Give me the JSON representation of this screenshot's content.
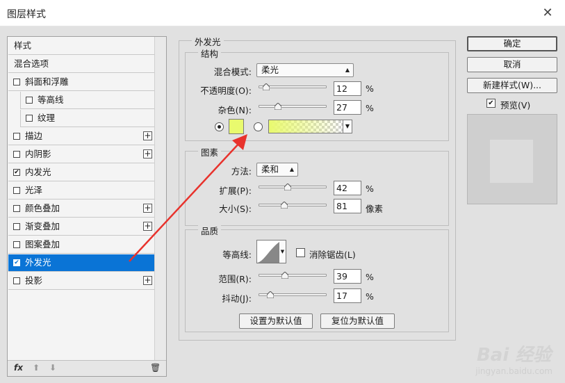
{
  "window": {
    "title": "图层样式",
    "close": "✕"
  },
  "style_list": {
    "items": [
      {
        "label": "样式",
        "checkbox": false,
        "checked": false,
        "plus": false,
        "sub": false,
        "selected": false
      },
      {
        "label": "混合选项",
        "checkbox": false,
        "checked": false,
        "plus": false,
        "sub": false,
        "selected": false
      },
      {
        "label": "斜面和浮雕",
        "checkbox": true,
        "checked": false,
        "plus": false,
        "sub": false,
        "selected": false
      },
      {
        "label": "等高线",
        "checkbox": true,
        "checked": false,
        "plus": false,
        "sub": true,
        "selected": false
      },
      {
        "label": "纹理",
        "checkbox": true,
        "checked": false,
        "plus": false,
        "sub": true,
        "selected": false
      },
      {
        "label": "描边",
        "checkbox": true,
        "checked": false,
        "plus": true,
        "sub": false,
        "selected": false
      },
      {
        "label": "内阴影",
        "checkbox": true,
        "checked": false,
        "plus": true,
        "sub": false,
        "selected": false
      },
      {
        "label": "内发光",
        "checkbox": true,
        "checked": true,
        "plus": false,
        "sub": false,
        "selected": false
      },
      {
        "label": "光泽",
        "checkbox": true,
        "checked": false,
        "plus": false,
        "sub": false,
        "selected": false
      },
      {
        "label": "颜色叠加",
        "checkbox": true,
        "checked": false,
        "plus": true,
        "sub": false,
        "selected": false
      },
      {
        "label": "渐变叠加",
        "checkbox": true,
        "checked": false,
        "plus": true,
        "sub": false,
        "selected": false
      },
      {
        "label": "图案叠加",
        "checkbox": true,
        "checked": false,
        "plus": false,
        "sub": false,
        "selected": false
      },
      {
        "label": "外发光",
        "checkbox": true,
        "checked": true,
        "plus": false,
        "sub": false,
        "selected": true
      },
      {
        "label": "投影",
        "checkbox": true,
        "checked": false,
        "plus": true,
        "sub": false,
        "selected": false
      }
    ],
    "footer": {
      "fx": "fx",
      "up": "⬆",
      "down": "⬇",
      "trash": "🗑"
    }
  },
  "panel": {
    "title": "外发光",
    "structure": {
      "title": "结构",
      "blend_mode_label": "混合模式:",
      "blend_mode_value": "柔光",
      "opacity_label": "不透明度(O):",
      "opacity_value": "12",
      "noise_label": "杂色(N):",
      "noise_value": "27",
      "percent": "%",
      "color": "#e9fa6e"
    },
    "elements": {
      "title": "图素",
      "technique_label": "方法:",
      "technique_value": "柔和",
      "spread_label": "扩展(P):",
      "spread_value": "42",
      "size_label": "大小(S):",
      "size_value": "81",
      "size_unit": "像素",
      "percent": "%"
    },
    "quality": {
      "title": "品质",
      "contour_label": "等高线:",
      "antialias_label": "消除锯齿(L)",
      "range_label": "范围(R):",
      "range_value": "39",
      "jitter_label": "抖动(J):",
      "jitter_value": "17",
      "percent": "%"
    },
    "make_default": "设置为默认值",
    "reset_default": "复位为默认值"
  },
  "buttons": {
    "ok": "确定",
    "cancel": "取消",
    "new_style": "新建样式(W)...",
    "preview": "预览(V)"
  },
  "watermark": {
    "brand": "Bai 经验",
    "url": "jingyan.baidu.com"
  }
}
